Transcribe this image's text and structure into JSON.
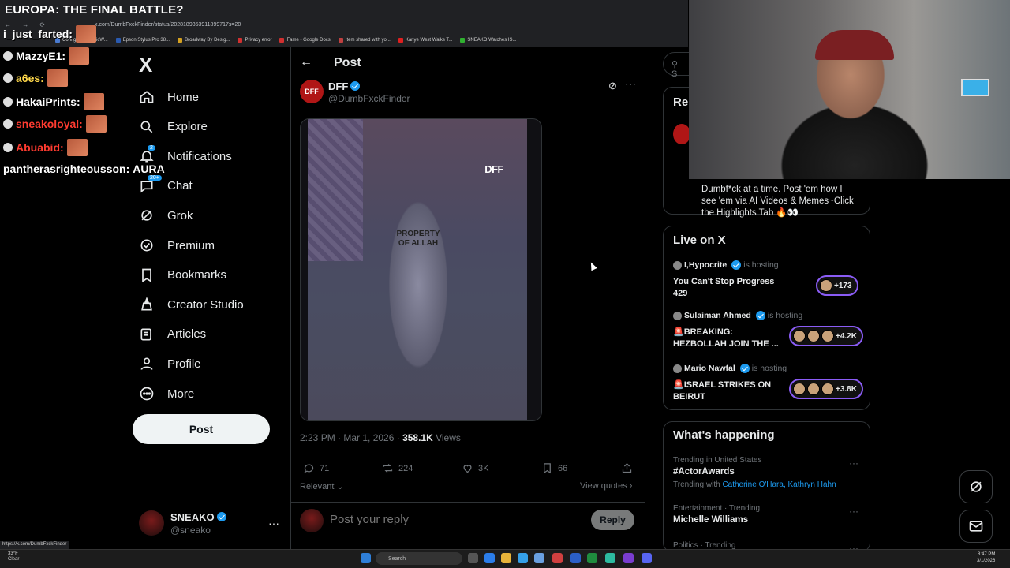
{
  "stream": {
    "title": "EUROPA: THE FINAL BATTLE?",
    "chat": [
      {
        "user": "i_just_farted:",
        "color": "#ffffff",
        "message": ""
      },
      {
        "user": "MazzyE1:",
        "color": "#ffffff",
        "message": ""
      },
      {
        "user": "a6es:",
        "color": "#ffd84a",
        "message": ""
      },
      {
        "user": "HakaiPrints:",
        "color": "#ffffff",
        "message": ""
      },
      {
        "user": "sneakoloyal:",
        "color": "#ff3b30",
        "message": ""
      },
      {
        "user": "Abuabid:",
        "color": "#ff3b30",
        "message": ""
      },
      {
        "user": "pantherasrighteousson:",
        "color": "#ffffff",
        "message": "AURA"
      }
    ]
  },
  "browser": {
    "url": "x.com/DumbFxckFinder/status/2028189353911899717s=20",
    "nav": "← → ⟳",
    "bookmarks": [
      {
        "label": "Configuring SonicW...",
        "color": "#4a7bd0"
      },
      {
        "label": "Epson Stylus Pro 38...",
        "color": "#2a5ab0"
      },
      {
        "label": "Broadway By Desig...",
        "color": "#d4a020"
      },
      {
        "label": "Privacy error",
        "color": "#d03030"
      },
      {
        "label": "Fame - Google Docs",
        "color": "#d03030"
      },
      {
        "label": "Item shared with yo...",
        "color": "#c04040"
      },
      {
        "label": "Kanye West Walks T...",
        "color": "#e02020"
      },
      {
        "label": "SNEAKO Watches IS...",
        "color": "#30b030"
      }
    ],
    "status_url": "https://x.com/DumbFxckFinder"
  },
  "nav": {
    "logo": "X",
    "items": [
      {
        "label": "Home",
        "icon": "home-icon"
      },
      {
        "label": "Explore",
        "icon": "search-icon"
      },
      {
        "label": "Notifications",
        "icon": "bell-icon",
        "badge": "2"
      },
      {
        "label": "Chat",
        "icon": "chat-icon",
        "badge": "20+"
      },
      {
        "label": "Grok",
        "icon": "grok-icon"
      },
      {
        "label": "Premium",
        "icon": "premium-icon"
      },
      {
        "label": "Bookmarks",
        "icon": "bookmark-icon"
      },
      {
        "label": "Creator Studio",
        "icon": "creator-studio-icon"
      },
      {
        "label": "Articles",
        "icon": "articles-icon"
      },
      {
        "label": "Profile",
        "icon": "profile-icon"
      },
      {
        "label": "More",
        "icon": "more-circle-icon"
      }
    ],
    "post_button": "Post",
    "account": {
      "name": "SNEAKO",
      "handle": "@sneako",
      "more": "···"
    }
  },
  "post": {
    "header": "Post",
    "author": {
      "avatar_text": "DFF",
      "name": "DFF",
      "handle": "@DumbFxckFinder"
    },
    "media": {
      "watermark": "DFF",
      "hoodie_text": "PROPERTY OF ALLAH"
    },
    "meta": {
      "time": "2:23 PM · Mar 1, 2026 · ",
      "views_count": "358.1K",
      "views_label": " Views"
    },
    "actions": {
      "replies": "71",
      "reposts": "224",
      "likes": "3K",
      "bookmarks": "66"
    },
    "sort": "Relevant",
    "view_quotes": "View quotes",
    "reply_placeholder": "Post your reply",
    "reply_button": "Reply"
  },
  "sidebar": {
    "search_placeholder": "S",
    "relevant": {
      "title": "Re",
      "bio": "Dumbf*ck at a time. Post 'em how I see 'em via AI Videos & Memes~Click the Highlights Tab 🔥👀"
    },
    "live": {
      "title": "Live on X",
      "hosting_label": "is hosting",
      "items": [
        {
          "host": "I,Hypocrite",
          "topic": "You Can't Stop Progress 429",
          "count": "+173"
        },
        {
          "host": "Sulaiman Ahmed",
          "topic": "🚨BREAKING: HEZBOLLAH JOIN THE ...",
          "count": "+4.2K"
        },
        {
          "host": "Mario Nawfal",
          "topic": "🚨ISRAEL STRIKES ON BEIRUT",
          "count": "+3.8K"
        }
      ]
    },
    "happening": {
      "title": "What's happening",
      "trends": [
        {
          "meta": "Trending in United States",
          "name": "#ActorAwards",
          "with_label": "Trending with ",
          "with": "Catherine O'Hara, Kathryn Hahn"
        },
        {
          "meta": "Entertainment · Trending",
          "name": "Michelle Williams"
        },
        {
          "meta": "Politics · Trending",
          "name": ""
        }
      ]
    }
  },
  "taskbar": {
    "weather_temp": "33°F",
    "weather_desc": "Clear",
    "search": "Search",
    "time": "8:47 PM",
    "date": "3/1/2026"
  },
  "colors": {
    "accent": "#1d9bf0",
    "background": "#000000",
    "border": "#2f3336",
    "muted": "#71767b",
    "live_ring": "#8b5cf6"
  }
}
